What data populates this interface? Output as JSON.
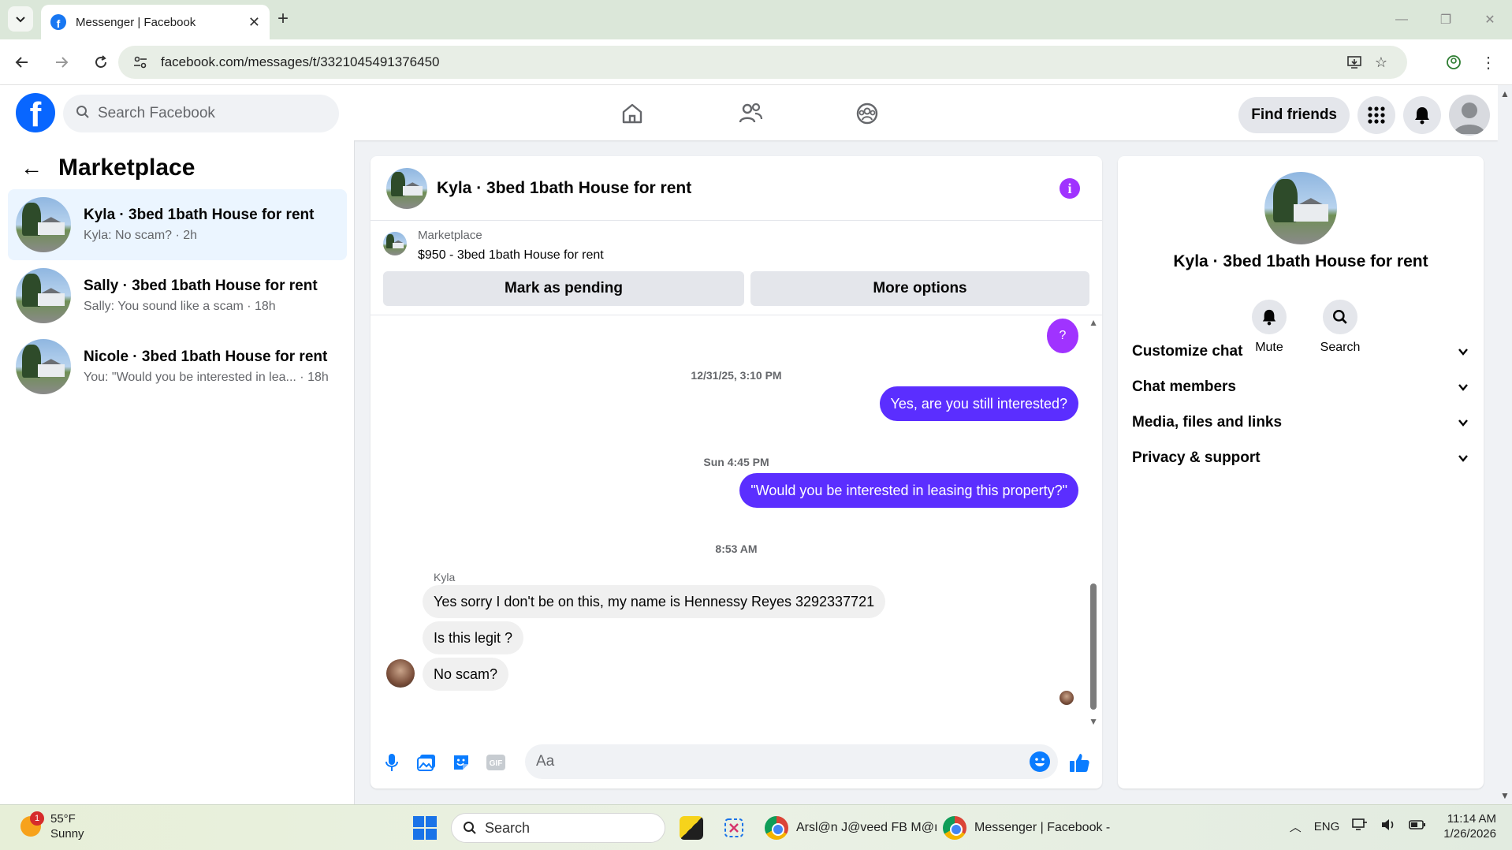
{
  "browser": {
    "tab_title": "Messenger | Facebook",
    "url": "facebook.com/messages/t/3321045491376450"
  },
  "fb": {
    "search_placeholder": "Search Facebook",
    "find_friends": "Find friends"
  },
  "sidebar": {
    "title": "Marketplace",
    "conversations": [
      {
        "name": "Kyla · 3bed 1bath House for rent",
        "preview": "Kyla: No scam? · 2h",
        "active": true
      },
      {
        "name": "Sally · 3bed 1bath House for rent",
        "preview": "Sally: You sound like a scam · 18h",
        "active": false
      },
      {
        "name": "Nicole · 3bed 1bath House for rent",
        "preview": "You: \"Would you be interested in lea... · 18h",
        "active": false
      }
    ]
  },
  "chat": {
    "title": "Kyla · 3bed 1bath House for rent",
    "marketplace_label": "Marketplace",
    "listing": "$950 - 3bed 1bath House for rent",
    "mark_pending": "Mark as pending",
    "more_options": "More options",
    "help_bubble": "?",
    "timestamps": [
      "12/31/25, 3:10 PM",
      "Sun 4:45 PM",
      "8:53 AM"
    ],
    "outgoing": [
      "Yes, are you still interested?",
      "\"Would you be interested in leasing this property?\""
    ],
    "sender": "Kyla",
    "incoming": [
      "Yes sorry I don't be on this, my name is Hennessy Reyes 3292337721",
      "Is this legit ?",
      "No scam?"
    ],
    "composer_placeholder": "Aa"
  },
  "details": {
    "name": "Kyla · 3bed 1bath House for rent",
    "mute": "Mute",
    "search": "Search",
    "sections": [
      "Customize chat",
      "Chat members",
      "Media, files and links",
      "Privacy & support"
    ]
  },
  "taskbar": {
    "temp": "55°F",
    "condition": "Sunny",
    "weather_badge": "1",
    "search": "Search",
    "app1": "Arsl@n J@veed FB M@ı",
    "app2": "Messenger | Facebook -",
    "lang": "ENG",
    "time": "11:14 AM",
    "date": "1/26/2026"
  }
}
